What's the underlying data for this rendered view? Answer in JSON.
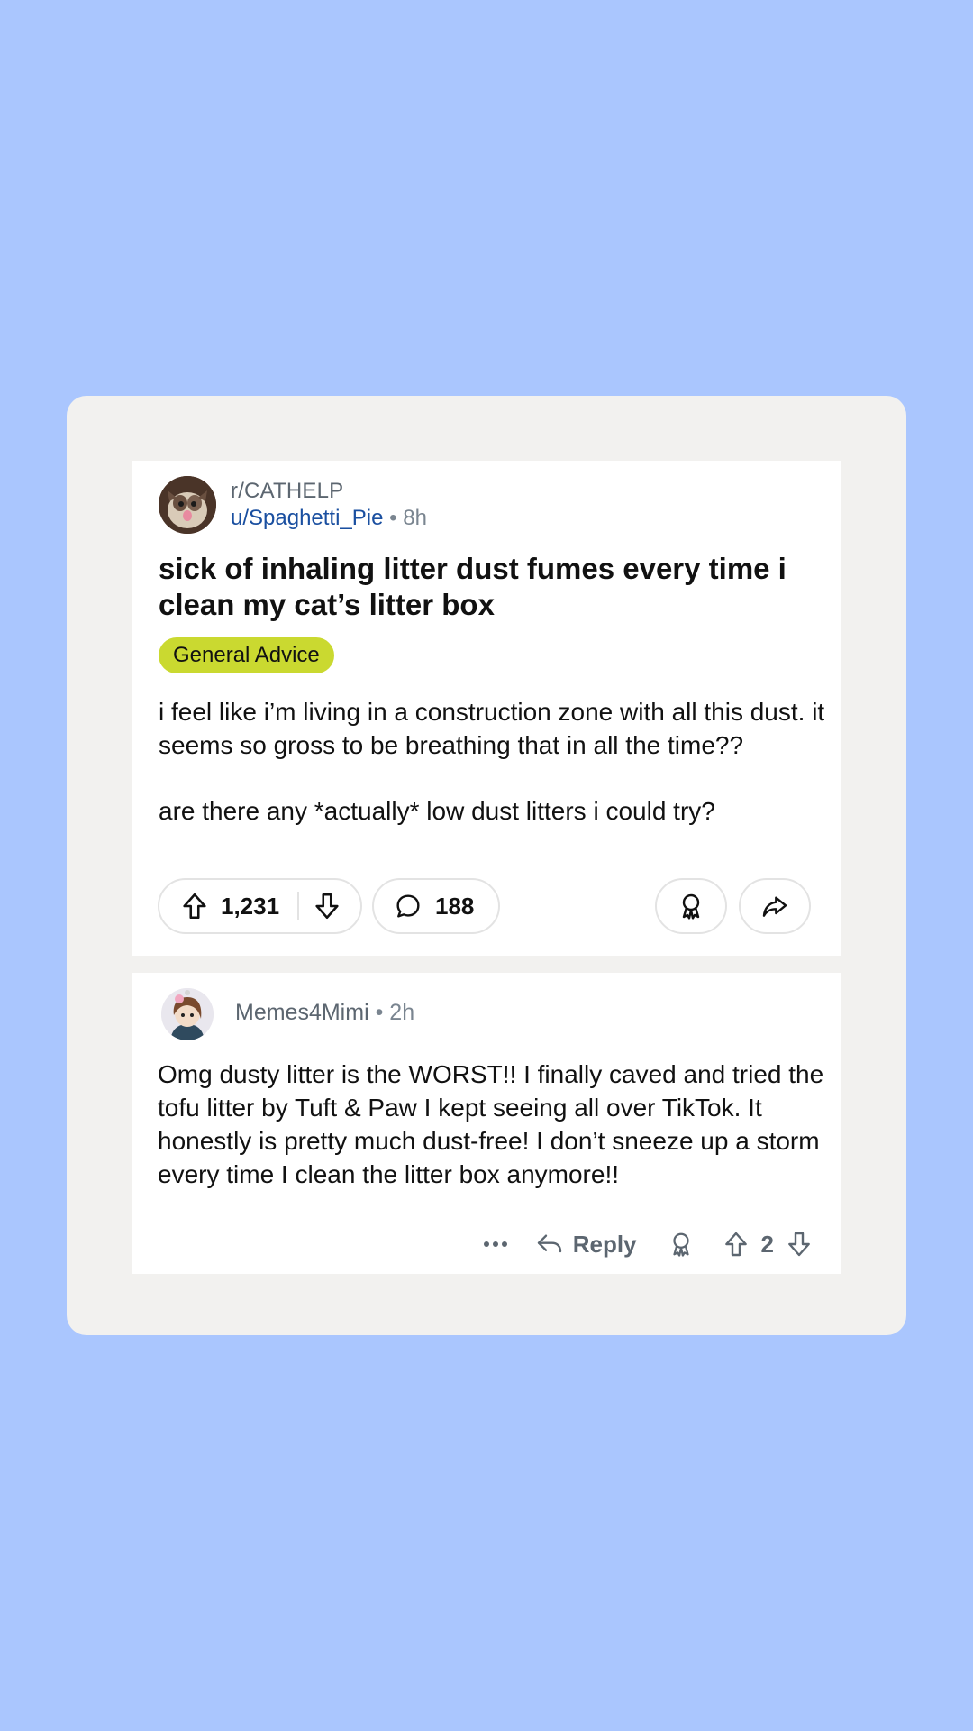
{
  "post": {
    "subreddit": "r/CATHELP",
    "username": "u/Spaghetti_Pie",
    "separator": "•",
    "age": "8h",
    "title": "sick of inhaling litter dust fumes every time i clean my cat’s litter box",
    "flair": "General Advice",
    "body_paragraphs": [
      "i feel like i’m living in a construction zone with all this dust. it seems so gross to be breathing that in all the time??",
      "are there any *actually* low dust litters i could try?"
    ],
    "upvotes": "1,231",
    "comment_count": "188",
    "icons": [
      "upvote-icon",
      "downvote-icon",
      "comment-icon",
      "award-icon",
      "share-icon"
    ]
  },
  "comment": {
    "username": "Memes4Mimi",
    "separator": "•",
    "age": "2h",
    "body": "Omg dusty litter is the WORST!! I finally caved and tried the tofu litter by Tuft & Paw I kept seeing all over TikTok. It honestly is pretty much dust-free! I don’t sneeze up a storm every time I clean the litter box anymore!!",
    "reply_label": "Reply",
    "score": "2",
    "icons": [
      "more-icon",
      "reply-icon",
      "award-icon",
      "upvote-icon",
      "downvote-icon"
    ]
  },
  "colors": {
    "background": "#aac6fe",
    "frame": "#f2f1ef",
    "card": "#ffffff",
    "flair": "#cad930",
    "username_link": "#1a4fa0"
  }
}
